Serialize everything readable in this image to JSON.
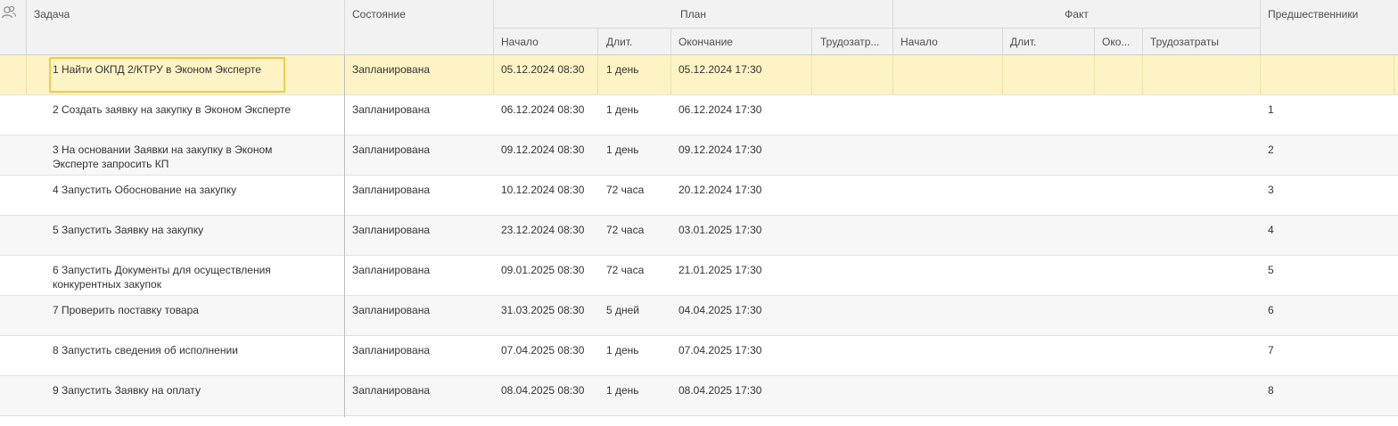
{
  "header": {
    "users_icon": "users-icon",
    "task": "Задача",
    "state": "Состояние",
    "plan_group": "План",
    "fact_group": "Факт",
    "predecessors": "Предшественники",
    "plan_start": "Начало",
    "plan_duration": "Длит.",
    "plan_end": "Окончание",
    "plan_labor": "Трудозатр...",
    "fact_start": "Начало",
    "fact_duration": "Длит.",
    "fact_end": "Око...",
    "fact_labor": "Трудозатраты"
  },
  "rows": [
    {
      "task": "1  Найти ОКПД 2/КТРУ в Эконом Эксперте",
      "state": "Запланирована",
      "start": "05.12.2024 08:30",
      "duration": "1 день",
      "end": "05.12.2024 17:30",
      "pred": ""
    },
    {
      "task": "2  Создать заявку на закупку в Эконом Эксперте",
      "state": "Запланирована",
      "start": "06.12.2024 08:30",
      "duration": "1 день",
      "end": "06.12.2024 17:30",
      "pred": "1"
    },
    {
      "task": "3  На основании Заявки на закупку в Эконом Эксперте запросить КП",
      "state": "Запланирована",
      "start": "09.12.2024 08:30",
      "duration": "1 день",
      "end": "09.12.2024 17:30",
      "pred": "2"
    },
    {
      "task": "4  Запустить Обоснование на закупку",
      "state": "Запланирована",
      "start": "10.12.2024 08:30",
      "duration": "72 часа",
      "end": "20.12.2024 17:30",
      "pred": "3"
    },
    {
      "task": "5  Запустить Заявку на закупку",
      "state": "Запланирована",
      "start": "23.12.2024 08:30",
      "duration": "72 часа",
      "end": "03.01.2025 17:30",
      "pred": "4"
    },
    {
      "task": "6  Запустить Документы для осуществления конкурентных закупок",
      "state": "Запланирована",
      "start": "09.01.2025 08:30",
      "duration": "72 часа",
      "end": "21.01.2025 17:30",
      "pred": "5"
    },
    {
      "task": "7  Проверить поставку товара",
      "state": "Запланирована",
      "start": "31.03.2025 08:30",
      "duration": "5 дней",
      "end": "04.04.2025 17:30",
      "pred": "6"
    },
    {
      "task": "8  Запустить сведения об исполнении",
      "state": "Запланирована",
      "start": "07.04.2025 08:30",
      "duration": "1 день",
      "end": "07.04.2025 17:30",
      "pred": "7"
    },
    {
      "task": "9  Запустить Заявку на оплату",
      "state": "Запланирована",
      "start": "08.04.2025 08:30",
      "duration": "1 день",
      "end": "08.04.2025 17:30",
      "pred": "8"
    }
  ],
  "colors": {
    "selected_row": "#fdf3c4",
    "focus_border": "#f2c94c",
    "header_bg": "#f2f2f2"
  }
}
